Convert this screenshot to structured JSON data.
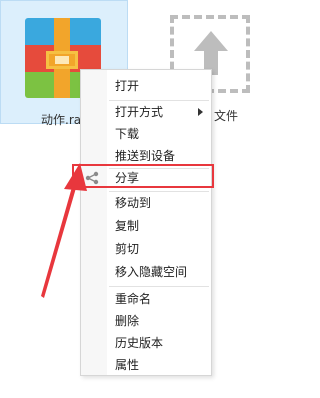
{
  "file": {
    "name": "动作.ra",
    "icon": "archive-rar-icon"
  },
  "placeholder_file": {
    "name_partial": "文件",
    "icon": "upload-arrow-icon"
  },
  "context_menu": {
    "items": [
      {
        "label": "打开"
      },
      {
        "label": "打开方式",
        "has_submenu": true
      },
      {
        "label": "下载"
      },
      {
        "label": "推送到设备"
      },
      {
        "label": "分享",
        "icon": "share-icon"
      },
      {
        "label": "移动到"
      },
      {
        "label": "复制"
      },
      {
        "label": "剪切"
      },
      {
        "label": "移入隐藏空间"
      },
      {
        "label": "重命名"
      },
      {
        "label": "删除"
      },
      {
        "label": "历史版本"
      },
      {
        "label": "属性"
      }
    ]
  },
  "colors": {
    "highlight": "#e8373d",
    "selection_bg": "#dceffc"
  }
}
